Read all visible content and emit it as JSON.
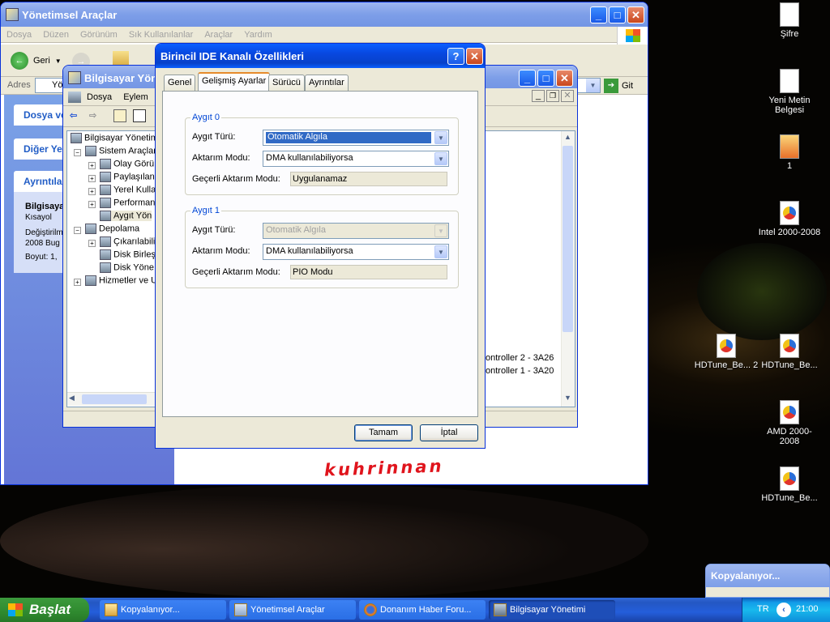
{
  "desktop_icons": [
    {
      "label": "Şifre",
      "type": "text",
      "x": "949",
      "y": "3"
    },
    {
      "label": "Yeni Metin Belgesi",
      "type": "text"
    },
    {
      "label": "1",
      "type": "image"
    },
    {
      "label": "Intel 2000-2008",
      "type": "text"
    },
    {
      "label": "HDTune_Be... 2",
      "type": "hdtune"
    },
    {
      "label": "HDTune_Be...",
      "type": "hdtune"
    },
    {
      "label": "AMD 2000-2008",
      "type": "hdtune"
    },
    {
      "label": "HDTune_Be...",
      "type": "hdtune"
    }
  ],
  "admin_window": {
    "title": "Yönetimsel Araçlar",
    "menu": [
      "Dosya",
      "Düzen",
      "Görünüm",
      "Sık Kullanılanlar",
      "Araçlar",
      "Yardım"
    ],
    "back_label": "Geri",
    "address_label": "Adres",
    "address_value": "Yö",
    "go_label": "Git",
    "panels": [
      "Dosya ve",
      "Diğer Ye",
      "Ayrıntıla"
    ],
    "details": {
      "name": "Bilgisaya",
      "type": "Kısayol",
      "modified_label": "Değiştirilm",
      "modified_value": "2008 Bug",
      "size": "Boyut: 1,"
    }
  },
  "comp_mgmt": {
    "title": "Bilgisayar Yönetimi",
    "menu": [
      "Dosya",
      "Eylem"
    ],
    "tree": [
      "Bilgisayar Yönetimi",
      "Sistem Araçları",
      "Olay Görü",
      "Paylaşılan",
      "Yerel Kulla",
      "Performan",
      "Aygıt Yön",
      "Depolama",
      "Çıkarılabili",
      "Disk Birleş",
      "Disk Yöne",
      "Hizmetler ve U"
    ],
    "right_items": [
      "ontroller 2 - 3A26",
      "ontroller 1 - 3A20"
    ]
  },
  "dialog": {
    "title": "Birincil IDE Kanalı Özellikleri",
    "tabs": [
      "Genel",
      "Gelişmiş Ayarlar",
      "Sürücü",
      "Ayrıntılar"
    ],
    "device0": {
      "legend": "Aygıt 0",
      "type_label": "Aygıt Türü:",
      "type_value": "Otomatik Algıla",
      "mode_label": "Aktarım Modu:",
      "mode_value": "DMA kullanılabiliyorsa",
      "current_label": "Geçerli Aktarım Modu:",
      "current_value": "Uygulanamaz"
    },
    "device1": {
      "legend": "Aygıt 1",
      "type_label": "Aygıt Türü:",
      "type_value": "Otomatik Algıla",
      "mode_label": "Aktarım Modu:",
      "mode_value": "DMA kullanılabiliyorsa",
      "current_label": "Geçerli Aktarım Modu:",
      "current_value": "PIO Modu"
    },
    "ok_label": "Tamam",
    "cancel_label": "İptal"
  },
  "handwriting": "kuhrinnan",
  "copy_popup": {
    "title": "Kopyalanıyor..."
  },
  "taskbar": {
    "start_label": "Başlat",
    "tasks": [
      "Kopyalanıyor...",
      "Yönetimsel Araçlar",
      "Donanım Haber Foru...",
      "Bilgisayar Yönetimi"
    ],
    "lang": "TR",
    "clock": "21:00"
  }
}
